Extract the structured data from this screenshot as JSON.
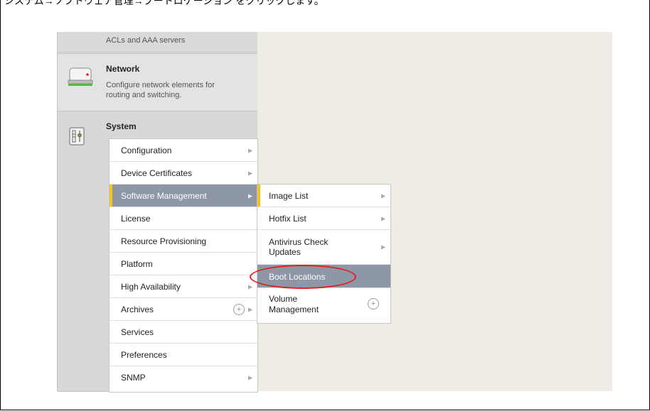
{
  "caption": "システム→ソフトウェア管理→ブートロケーション をクリックします。",
  "sidebar": {
    "security_desc": "ACLs and AAA servers",
    "network": {
      "title": "Network",
      "description_line1": "Configure network elements for",
      "description_line2": "routing and switching."
    },
    "system": {
      "title": "System"
    }
  },
  "system_menu": [
    {
      "label": "Configuration",
      "has_submenu": true
    },
    {
      "label": "Device Certificates",
      "has_submenu": true
    },
    {
      "label": "Software Management",
      "has_submenu": true,
      "selected": true
    },
    {
      "label": "License",
      "has_submenu": false
    },
    {
      "label": "Resource Provisioning",
      "has_submenu": false
    },
    {
      "label": "Platform",
      "has_submenu": false
    },
    {
      "label": "High Availability",
      "has_submenu": true
    },
    {
      "label": "Archives",
      "has_submenu": true,
      "has_add": true
    },
    {
      "label": "Services",
      "has_submenu": false
    },
    {
      "label": "Preferences",
      "has_submenu": false
    },
    {
      "label": "SNMP",
      "has_submenu": true
    }
  ],
  "software_submenu": [
    {
      "label": "Image List",
      "has_submenu": true
    },
    {
      "label": "Hotfix List",
      "has_submenu": true
    },
    {
      "label_line1": "Antivirus Check",
      "label_line2": "Updates",
      "has_submenu": true
    },
    {
      "label": "Boot Locations",
      "highlighted": true
    },
    {
      "label_line1": "Volume",
      "label_line2": "Management",
      "has_add": true
    }
  ],
  "icons": {
    "network": "network-drive-icon",
    "system": "system-sliders-icon",
    "arrow": "▸",
    "add": "+"
  },
  "colors": {
    "selected_bg": "#8d97a6",
    "active_bar": "#f6c51d",
    "annotation": "#e02020"
  }
}
